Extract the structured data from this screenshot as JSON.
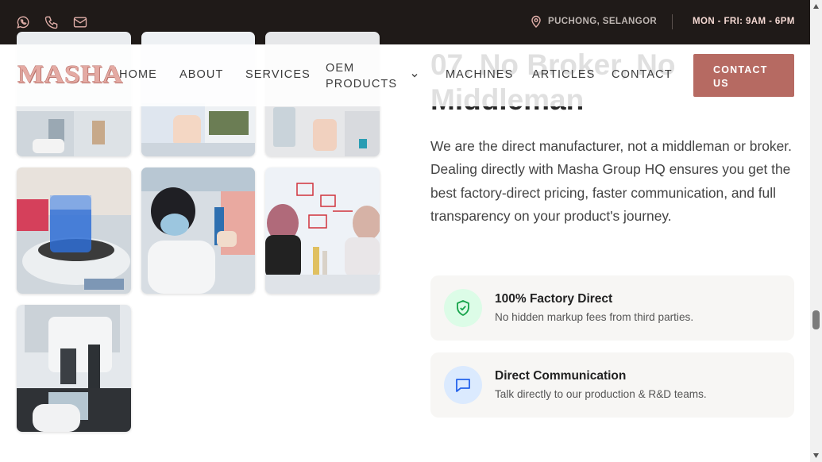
{
  "topbar": {
    "location": "PUCHONG, SELANGOR",
    "hours": "MON - FRI: 9AM - 6PM",
    "icons": [
      "whatsapp-icon",
      "phone-icon",
      "mail-icon",
      "map-pin-icon"
    ]
  },
  "nav": {
    "logo": "MASHA",
    "items": [
      "HOME",
      "ABOUT",
      "SERVICES",
      "OEM PRODUCTS",
      "MACHINES",
      "ARTICLES",
      "CONTACT"
    ],
    "cta": "CONTACT US"
  },
  "section": {
    "heading": "07. No Broker, No Middleman",
    "paragraph": "We are the direct manufacturer, not a middleman or broker. Dealing directly with Masha Group HQ ensures you get the best factory-direct pricing, faster communication, and full transparency on your product's journey."
  },
  "features": [
    {
      "title": "100% Factory Direct",
      "subtitle": "No hidden markup fees from third parties.",
      "icon": "shield-check-icon",
      "color": "#16a34a",
      "bg": "#dcfce7"
    },
    {
      "title": "Direct Communication",
      "subtitle": "Talk directly to our production & R&D teams.",
      "icon": "chat-icon",
      "color": "#2563eb",
      "bg": "#dbeafe"
    }
  ],
  "colors": {
    "topbar": "#1f1a18",
    "brand": "#b66a62",
    "hours": "#f5d9d3"
  }
}
